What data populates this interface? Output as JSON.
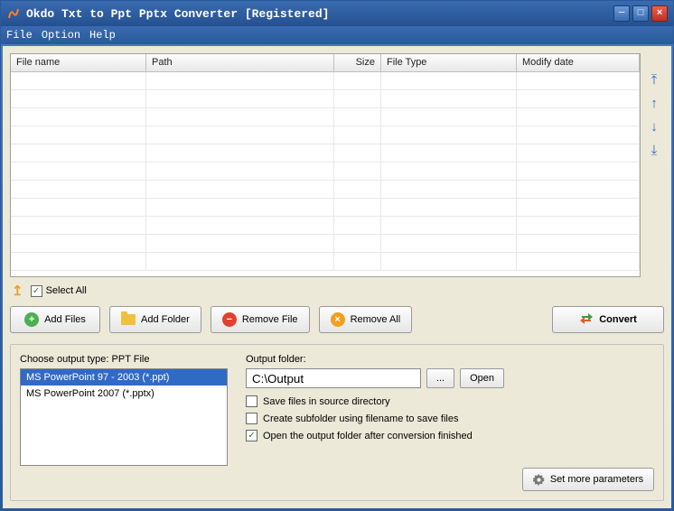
{
  "title": "Okdo Txt to Ppt Pptx Converter [Registered]",
  "menu": {
    "file": "File",
    "option": "Option",
    "help": "Help"
  },
  "grid": {
    "columns": {
      "name": "File name",
      "path": "Path",
      "size": "Size",
      "type": "File Type",
      "date": "Modify date"
    },
    "rows": []
  },
  "select_all": "Select All",
  "buttons": {
    "add_files": "Add Files",
    "add_folder": "Add Folder",
    "remove_file": "Remove File",
    "remove_all": "Remove All",
    "convert": "Convert"
  },
  "output_type_label": "Choose output type:  PPT File",
  "output_types": [
    "MS PowerPoint 97 - 2003 (*.ppt)",
    "MS PowerPoint 2007 (*.pptx)"
  ],
  "output": {
    "label": "Output folder:",
    "path": "C:\\Output",
    "browse": "...",
    "open": "Open",
    "save_source": "Save files in source directory",
    "create_sub": "Create subfolder using filename to save files",
    "open_after": "Open the output folder after conversion finished",
    "more_params": "Set more parameters"
  },
  "checks": {
    "save_source": false,
    "create_sub": false,
    "open_after": true
  },
  "colors": {
    "accent": "#2a5a9a",
    "select": "#316ac5"
  }
}
